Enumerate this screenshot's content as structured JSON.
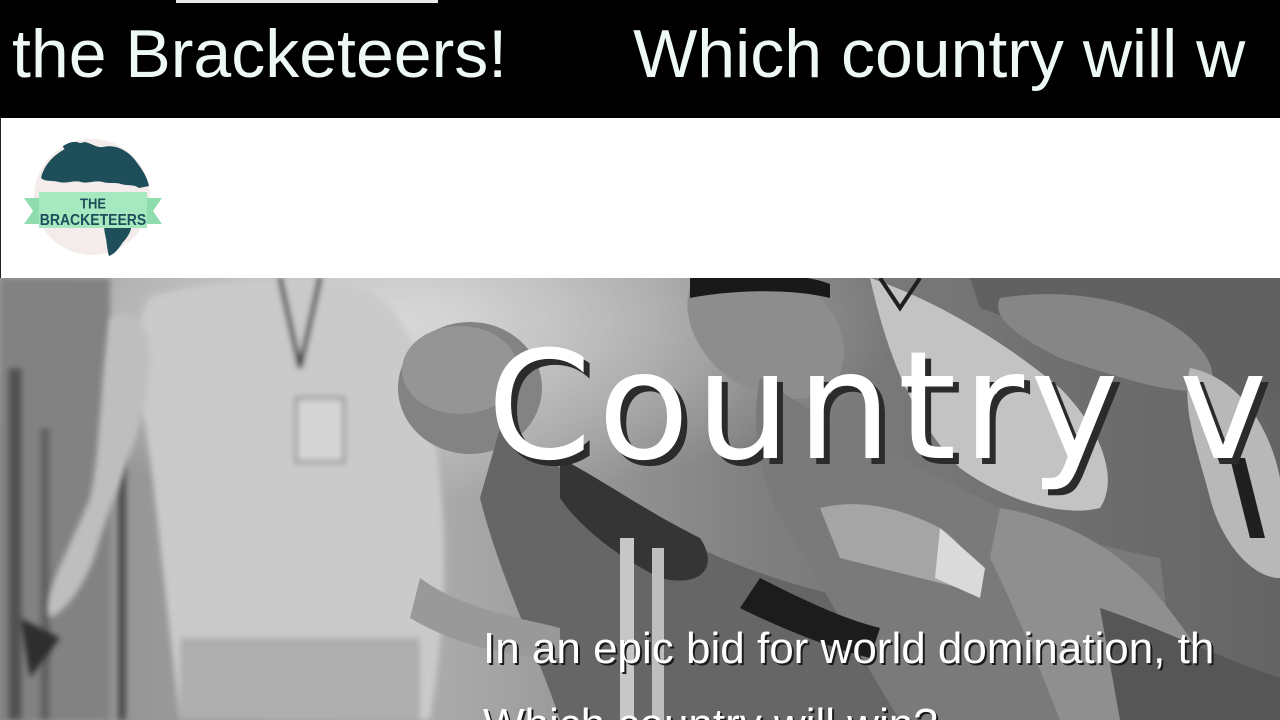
{
  "ticker": {
    "items": [
      "the Bracketeers!",
      "Which country will w"
    ]
  },
  "header": {
    "logo": {
      "line1": "THE",
      "line2": "BRACKETEERS",
      "colors": {
        "globe": "#1e4e5a",
        "land": "#f3ecea",
        "ribbon": "#a6e8c0"
      }
    }
  },
  "hero": {
    "title": "Country v",
    "subtitle": "In an epic bid for world domination, th",
    "subtitle2": "Which country will win?",
    "image": "grayscale-sprinters-at-starting-line"
  },
  "colors": {
    "ticker_bg": "#000000",
    "ticker_text": "#eef9f7",
    "header_bg": "#ffffff"
  }
}
